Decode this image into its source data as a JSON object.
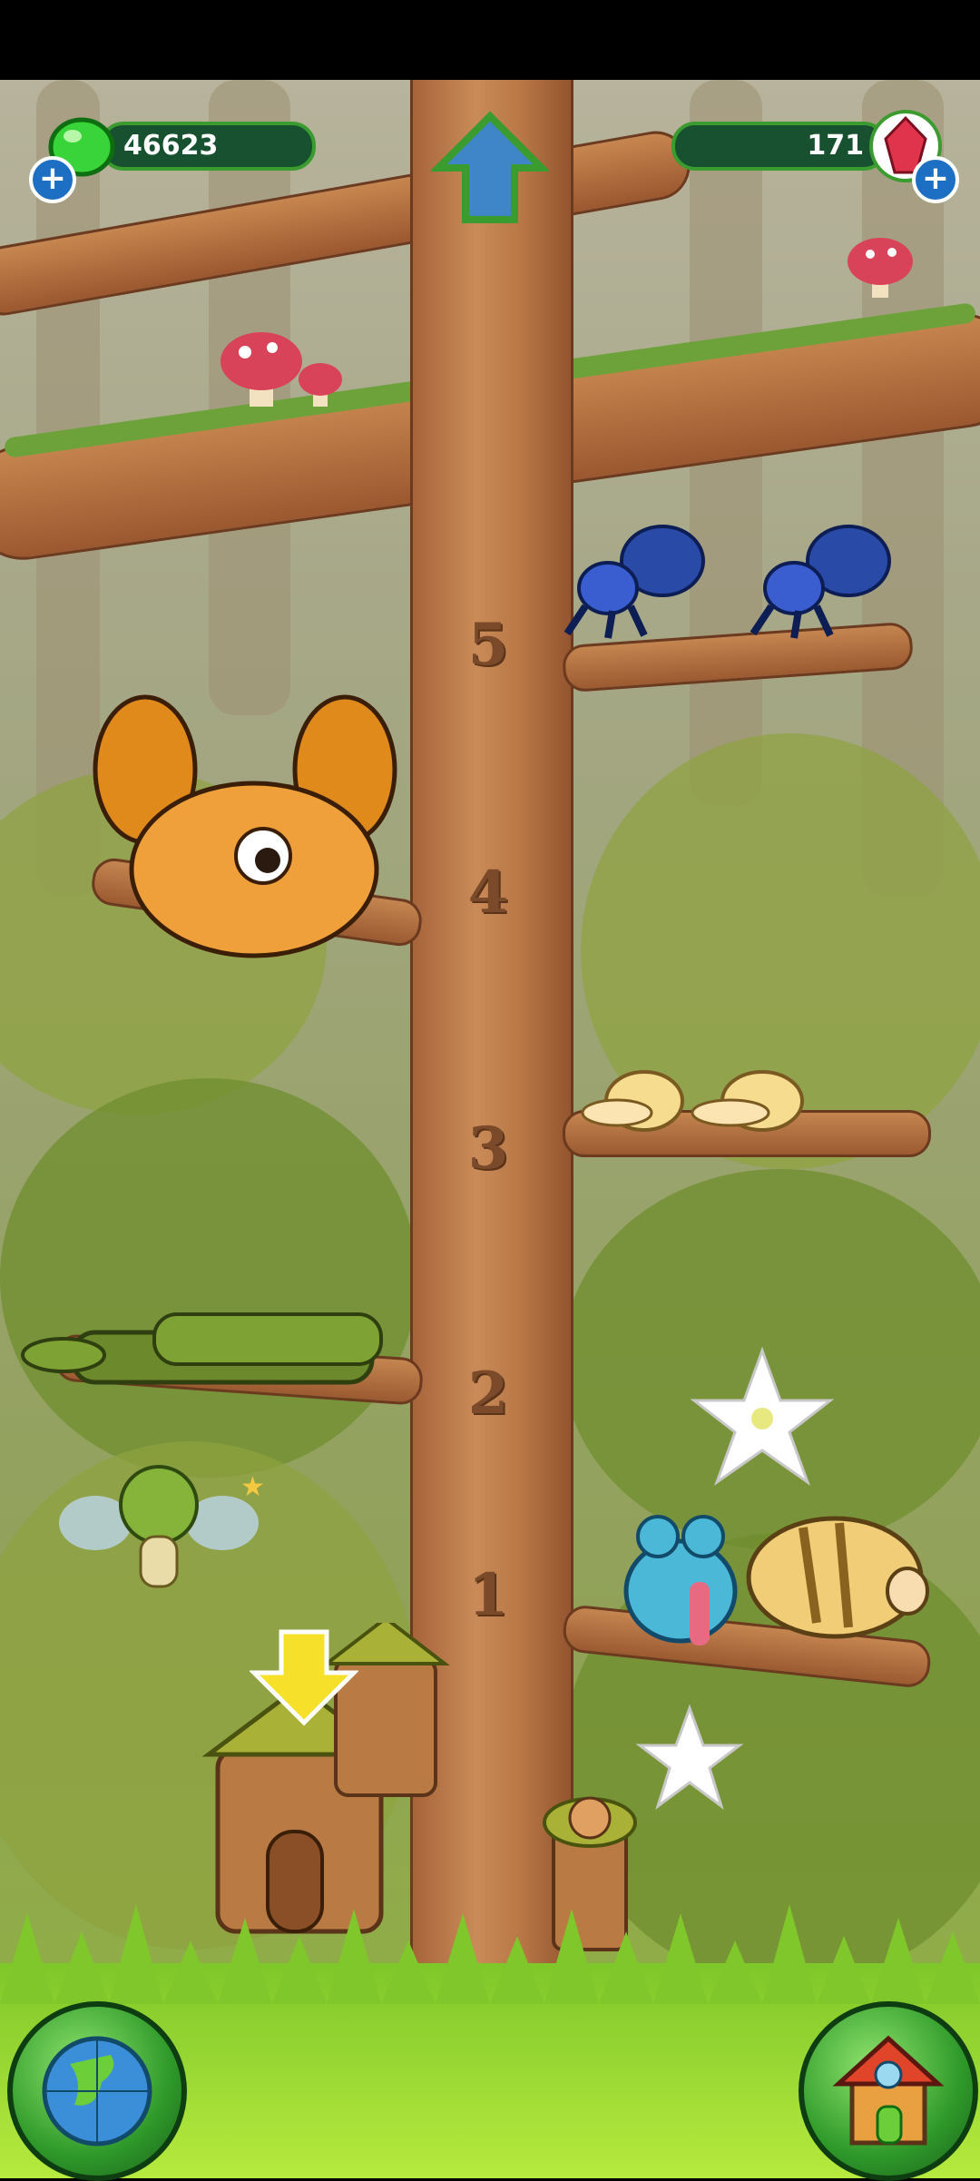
{
  "hud": {
    "gems_green": "46623",
    "gems_red": "171",
    "plus_symbol": "+"
  },
  "floors": [
    "1",
    "2",
    "3",
    "4",
    "5"
  ],
  "icons": {
    "up_arrow": "up-arrow-icon",
    "down_arrow": "down-arrow-icon",
    "globe": "globe-icon",
    "house": "house-icon",
    "green_gem": "green-gem-icon",
    "red_gem": "red-crystal-icon"
  },
  "colors": {
    "hud_bar": "#17512f",
    "hud_border": "#3a9b2e",
    "trunk": "#c98b58",
    "grass": "#9ad835",
    "plus_blue": "#1c6fc2"
  }
}
